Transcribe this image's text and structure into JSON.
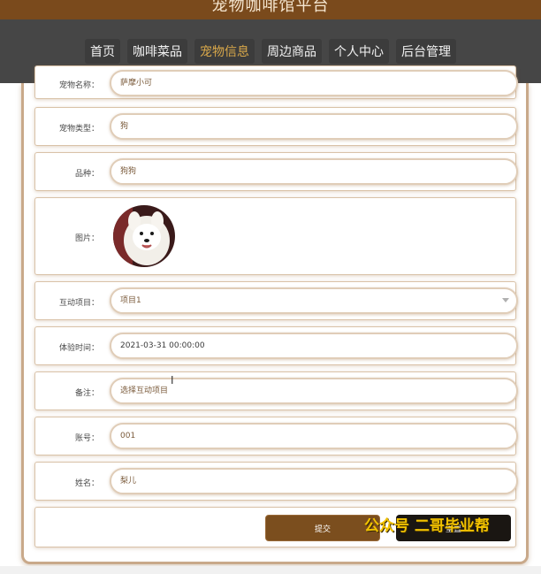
{
  "site": {
    "title": "宠物咖啡馆平台"
  },
  "nav": {
    "items": [
      {
        "label": "首页"
      },
      {
        "label": "咖啡菜品"
      },
      {
        "label": "宠物信息"
      },
      {
        "label": "周边商品"
      },
      {
        "label": "个人中心"
      },
      {
        "label": "后台管理"
      }
    ],
    "active_index": 2,
    "active_color": "#d9a84a"
  },
  "form": {
    "pet_name": {
      "label": "宠物名称：",
      "value": "萨摩小可"
    },
    "pet_type": {
      "label": "宠物类型：",
      "value": "狗"
    },
    "breed": {
      "label": "品种：",
      "value": "狗狗"
    },
    "image": {
      "label": "图片："
    },
    "activity": {
      "label": "互动项目：",
      "value": "项目1"
    },
    "time": {
      "label": "体验时间：",
      "value": "2021-03-31 00:00:00"
    },
    "note": {
      "label": "备注：",
      "value": "选择互动项目"
    },
    "account": {
      "label": "账号：",
      "value": "001"
    },
    "name": {
      "label": "姓名：",
      "value": "梨儿"
    }
  },
  "buttons": {
    "submit": "提交",
    "reset": "重置"
  },
  "watermark": "公众号 二哥毕业帮",
  "colors": {
    "brand_brown": "#7b4e1e",
    "nav_bg": "#464646",
    "accent": "#d9a84a"
  }
}
